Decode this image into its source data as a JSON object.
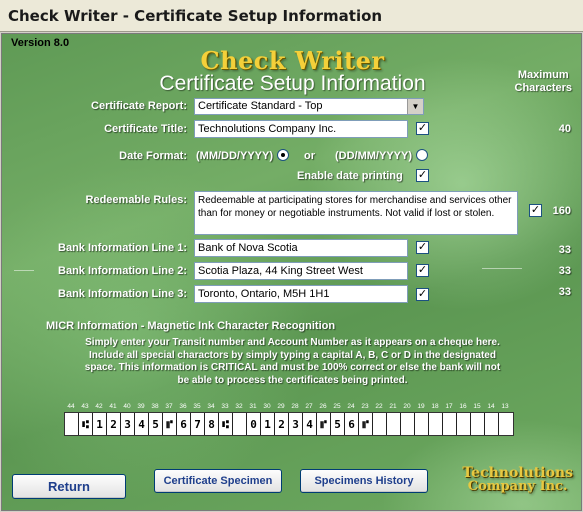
{
  "window": {
    "title": "Check Writer - Certificate Setup Information"
  },
  "header": {
    "version": "Version 8.0",
    "app_title": "Check Writer",
    "subtitle": "Certificate Setup Information",
    "max_chars_line1": "Maximum",
    "max_chars_line2": "Characters"
  },
  "form": {
    "certificate_report": {
      "label": "Certificate Report:",
      "value": "Certificate Standard - Top"
    },
    "certificate_title": {
      "label": "Certificate Title:",
      "value": "Technolutions Company Inc.",
      "checked": true,
      "max": "40"
    },
    "date_format": {
      "label": "Date Format:",
      "option1": "(MM/DD/YYYY)",
      "or_text": "or",
      "option2": "(DD/MM/YYYY)",
      "selected": "option1"
    },
    "enable_date_printing": {
      "label": "Enable date printing",
      "checked": true
    },
    "redeemable_rules": {
      "label": "Redeemable Rules:",
      "value": "Redeemable at participating stores for merchandise and services other than for money or negotiable instruments.  Not valid if lost or stolen.",
      "checked": true,
      "max": "160"
    },
    "bank_line1": {
      "label": "Bank Information Line 1:",
      "value": "Bank of Nova Scotia",
      "checked": true,
      "max": "33"
    },
    "bank_line2": {
      "label": "Bank Information Line 2:",
      "value": "Scotia Plaza, 44 King Street West",
      "checked": true,
      "max": "33"
    },
    "bank_line3": {
      "label": "Bank Information Line 3:",
      "value": "Toronto, Ontario, M5H 1H1",
      "checked": true,
      "max": "33"
    }
  },
  "micr": {
    "title": "MICR Information - Magnetic Ink Character Recognition",
    "instructions": [
      "Simply enter your Transit number and Account Number as it appears on a cheque here.",
      "Include all special charactors by simply typing a capital A, B, C or D in the designated",
      "space.  This information is CRITICAL and must be 100% correct or else the bank will not",
      "be able to process the certificates being printed."
    ],
    "column_numbers": [
      "44",
      "43",
      "42",
      "41",
      "40",
      "39",
      "38",
      "37",
      "36",
      "35",
      "34",
      "33",
      "32",
      "31",
      "30",
      "29",
      "28",
      "27",
      "26",
      "25",
      "24",
      "23",
      "22",
      "21",
      "20",
      "19",
      "18",
      "17",
      "16",
      "15",
      "14",
      "13"
    ],
    "cells": [
      "",
      "⑆",
      "1",
      "2",
      "3",
      "4",
      "5",
      "⑈",
      "6",
      "7",
      "8",
      "⑆",
      "",
      "0",
      "1",
      "2",
      "3",
      "4",
      "⑈",
      "5",
      "6",
      "⑈",
      "",
      "",
      "",
      "",
      "",
      "",
      "",
      "",
      "",
      ""
    ]
  },
  "buttons": {
    "return": "Return",
    "certificate_specimen": "Certificate Specimen",
    "specimens_history": "Specimens History"
  },
  "logo": {
    "line1": "Technolutions",
    "line2": "Company Inc."
  }
}
